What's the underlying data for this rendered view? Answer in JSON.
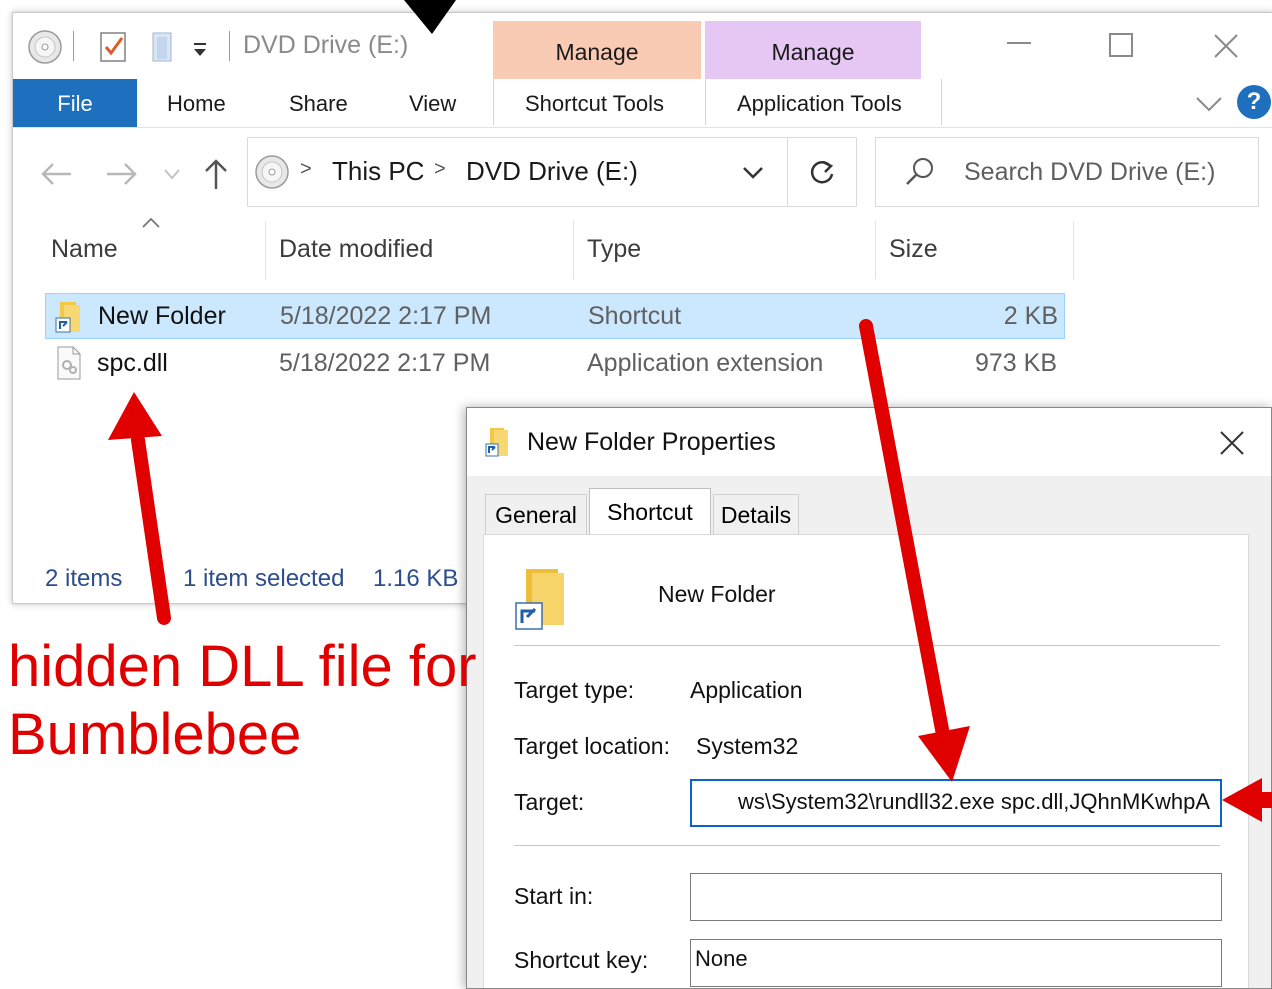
{
  "explorer": {
    "window_title": "DVD Drive (E:)",
    "contextual_groups": [
      {
        "header": "Manage",
        "tab": "Shortcut Tools",
        "color": "#f9cbb4"
      },
      {
        "header": "Manage",
        "tab": "Application Tools",
        "color": "#e6c7f3"
      }
    ],
    "ribbon_tabs": [
      "File",
      "Home",
      "Share",
      "View"
    ],
    "file_tab_color": "#1f6fbf",
    "help_label": "?",
    "address": {
      "segments": [
        "This PC",
        "DVD Drive (E:)"
      ],
      "separator": ">"
    },
    "search_placeholder": "Search DVD Drive (E:)",
    "columns": {
      "name": "Name",
      "date": "Date modified",
      "type": "Type",
      "size": "Size"
    },
    "files": [
      {
        "name": "New Folder",
        "date": "5/18/2022 2:17 PM",
        "type": "Shortcut",
        "size": "2 KB",
        "selected": true
      },
      {
        "name": "spc.dll",
        "date": "5/18/2022 2:17 PM",
        "type": "Application extension",
        "size": "973 KB",
        "selected": false
      }
    ],
    "status": {
      "items": "2 items",
      "selected": "1 item selected",
      "size": "1.16 KB"
    }
  },
  "dialog": {
    "title": "New Folder Properties",
    "tabs": [
      "General",
      "Shortcut",
      "Details"
    ],
    "active_tab": "Shortcut",
    "shortcut_name": "New Folder",
    "target_type_label": "Target type:",
    "target_type": "Application",
    "target_location_label": "Target location:",
    "target_location": "System32",
    "target_label": "Target:",
    "target_value": "ws\\System32\\rundll32.exe spc.dll,JQhnMKwhpA",
    "start_in_label": "Start in:",
    "start_in_value": "",
    "shortcut_key_label": "Shortcut key:",
    "shortcut_key_value": "None"
  },
  "annotation": {
    "lines": [
      "hidden DLL file for",
      "Bumblebee"
    ],
    "color": "#e00000"
  },
  "icons": [
    "dvd-icon",
    "properties-check-icon",
    "folder-icon",
    "dropdown-icon",
    "minimize-icon",
    "maximize-icon",
    "close-icon",
    "chevron-down-icon",
    "help-icon",
    "back-arrow-icon",
    "forward-arrow-icon",
    "up-arrow-icon",
    "refresh-icon",
    "search-icon",
    "sort-up-icon",
    "shortcut-folder-icon",
    "dll-file-icon"
  ]
}
